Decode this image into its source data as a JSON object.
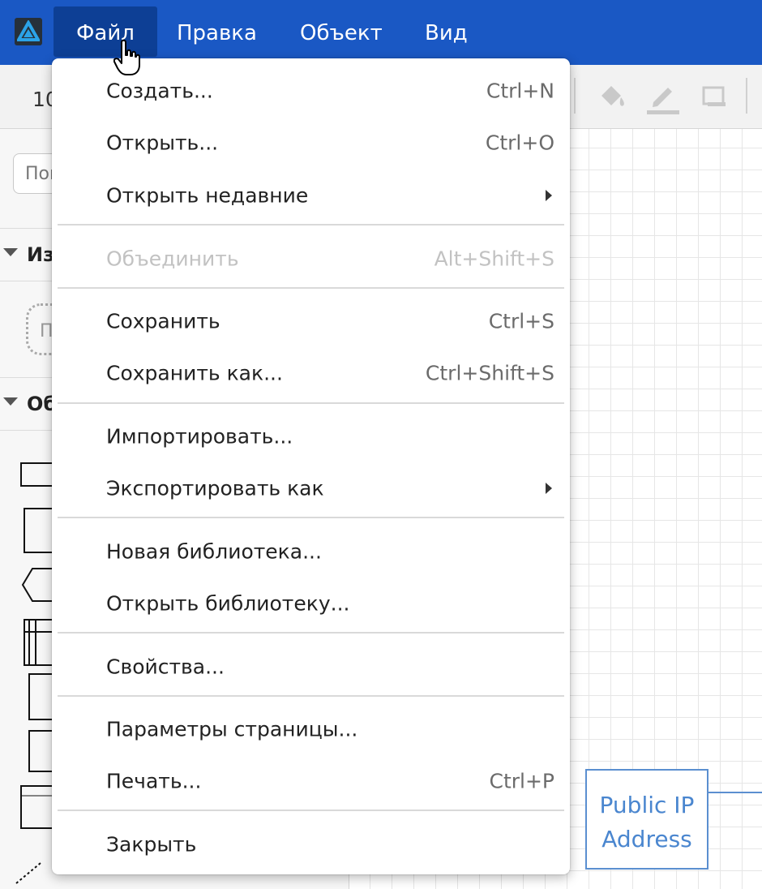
{
  "menubar": {
    "tabs": [
      {
        "label": "Файл",
        "active": true
      },
      {
        "label": "Правка",
        "active": false
      },
      {
        "label": "Объект",
        "active": false
      },
      {
        "label": "Вид",
        "active": false
      }
    ]
  },
  "toolbar": {
    "zoom_partial": "10",
    "icons": [
      "fill-color-icon",
      "line-color-icon",
      "shadow-icon"
    ]
  },
  "sidebar": {
    "search_placeholder": "Пои",
    "sections": [
      {
        "label": "Из"
      },
      {
        "label": "Об"
      }
    ],
    "shape_partial_label": "П"
  },
  "canvas": {
    "shape_label_line1": "Public IP",
    "shape_label_line2": "Address"
  },
  "file_menu": {
    "items": [
      {
        "label": "Создать...",
        "shortcut": "Ctrl+N"
      },
      {
        "label": "Открыть...",
        "shortcut": "Ctrl+O"
      },
      {
        "label": "Открыть недавние",
        "submenu": true
      },
      {
        "label": "Объединить",
        "shortcut": "Alt+Shift+S",
        "disabled": true
      },
      {
        "label": "Сохранить",
        "shortcut": "Ctrl+S"
      },
      {
        "label": "Сохранить как...",
        "shortcut": "Ctrl+Shift+S"
      },
      {
        "label": "Импортировать..."
      },
      {
        "label": "Экспортировать как",
        "submenu": true
      },
      {
        "label": "Новая библиотека..."
      },
      {
        "label": "Открыть библиотеку..."
      },
      {
        "label": "Свойства..."
      },
      {
        "label": "Параметры страницы..."
      },
      {
        "label": "Печать...",
        "shortcut": "Ctrl+P"
      },
      {
        "label": "Закрыть"
      }
    ]
  },
  "colors": {
    "menubar_bg": "#1a58c4",
    "active_tab_bg": "#0d3f95",
    "disabled_text": "#c2c2c2",
    "shape_border": "#5b8fd0"
  }
}
